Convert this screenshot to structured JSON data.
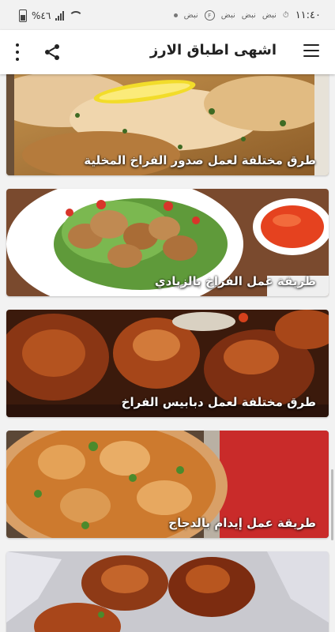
{
  "status_bar": {
    "battery": "%٤٦",
    "time": "١١:٤٠",
    "notif_1": "نبض",
    "notif_2": "نبض",
    "notif_3": "نبض",
    "notif_4": "نبض",
    "notif_f": "F"
  },
  "app_bar": {
    "title": "اشهى اطباق الارز"
  },
  "icons": {
    "menu": "hamburger-menu-icon",
    "share": "share-icon",
    "more": "more-vertical-icon"
  },
  "articles": [
    {
      "title": "طرق مختلفة لعمل صدور الفراخ المخلية"
    },
    {
      "title": "طريقة عمل الفراخ بالزبادي"
    },
    {
      "title": "طرق مختلفة لعمل دبابيس الفراخ"
    },
    {
      "title": "طريقة عمل إيدام بالدجاج"
    },
    {
      "title": ""
    }
  ]
}
